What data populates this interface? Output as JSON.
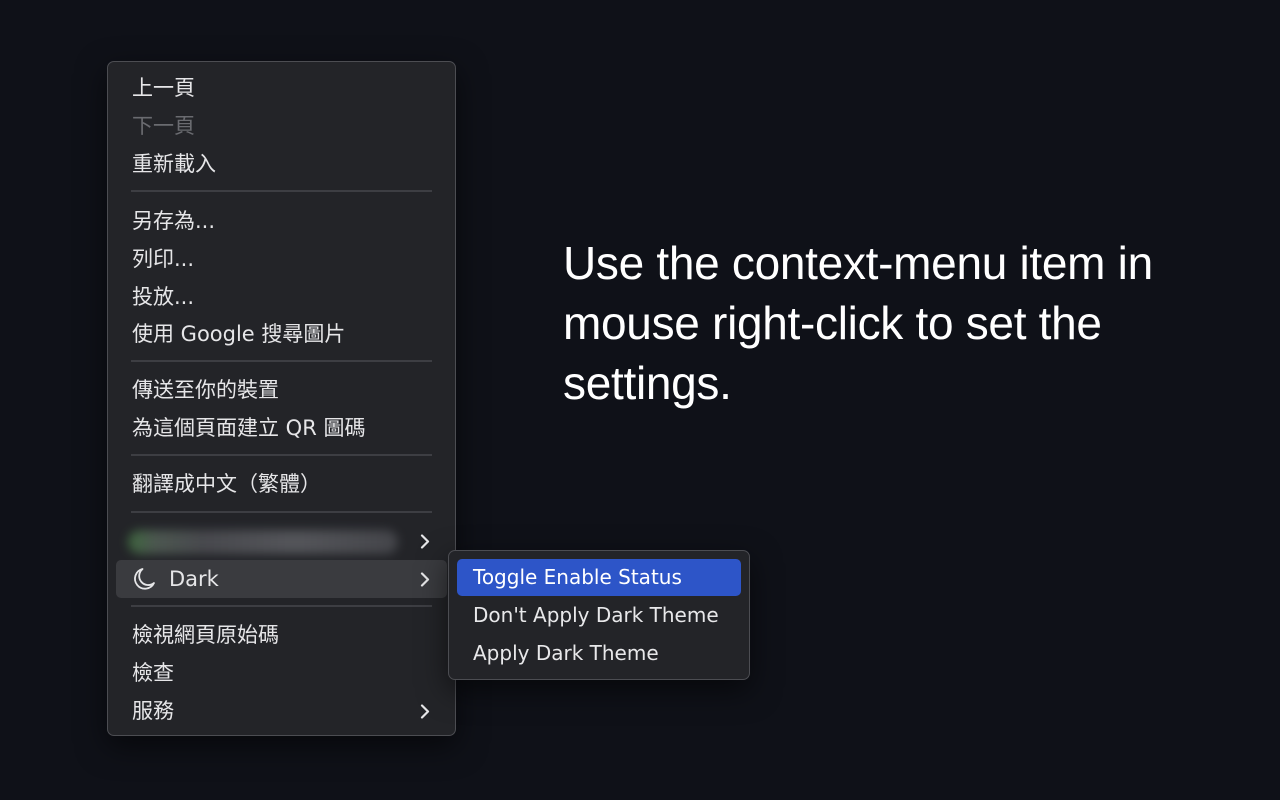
{
  "context_menu": {
    "items": [
      {
        "label": "上一頁",
        "enabled": true
      },
      {
        "label": "下一頁",
        "enabled": false
      },
      {
        "label": "重新載入",
        "enabled": true
      },
      {
        "label": "另存為...",
        "enabled": true
      },
      {
        "label": "列印...",
        "enabled": true
      },
      {
        "label": "投放...",
        "enabled": true
      },
      {
        "label": "使用 Google 搜尋圖片",
        "enabled": true
      },
      {
        "label": "傳送至你的裝置",
        "enabled": true
      },
      {
        "label": "為這個頁面建立 QR 圖碼",
        "enabled": true
      },
      {
        "label": "翻譯成中文（繁體）",
        "enabled": true
      },
      {
        "label": "",
        "enabled": true,
        "submenu": true,
        "obscured": true
      },
      {
        "label": "Dark",
        "enabled": true,
        "submenu": true,
        "icon": "moon-icon",
        "active": true
      },
      {
        "label": "檢視網頁原始碼",
        "enabled": true
      },
      {
        "label": "檢查",
        "enabled": true
      },
      {
        "label": "服務",
        "enabled": true,
        "submenu": true
      }
    ]
  },
  "dark_submenu": {
    "items": [
      {
        "label": "Toggle Enable Status",
        "highlighted": true
      },
      {
        "label": "Don't Apply Dark Theme",
        "highlighted": false
      },
      {
        "label": "Apply Dark Theme",
        "highlighted": false
      }
    ]
  },
  "caption": {
    "text": "Use the context-menu item in mouse right-click to set the settings."
  },
  "colors": {
    "background": "#0f1118",
    "menu_background": "#232428",
    "highlight": "#2d55c8",
    "disabled_text": "#6a6b70"
  }
}
